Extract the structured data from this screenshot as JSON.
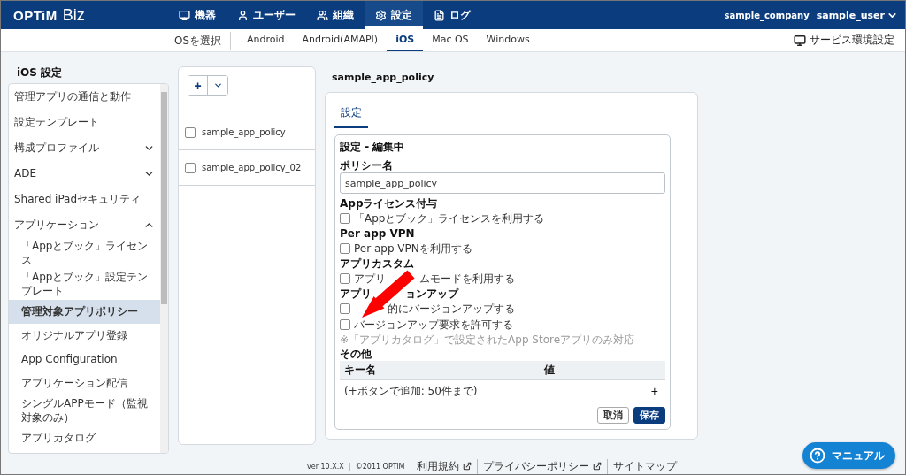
{
  "header": {
    "brand": "OPTiM",
    "product": "Biz",
    "company": "sample_company",
    "user": "sample_user",
    "nav": [
      {
        "label": "機器",
        "selected": false
      },
      {
        "label": "ユーザー",
        "selected": false
      },
      {
        "label": "組織",
        "selected": false
      },
      {
        "label": "設定",
        "selected": true
      },
      {
        "label": "ログ",
        "selected": false
      }
    ]
  },
  "subnav": {
    "label": "OSを選択",
    "service_link": "サービス環境設定",
    "os_tabs": [
      {
        "label": "Android",
        "selected": false
      },
      {
        "label": "Android(AMAPI)",
        "selected": false
      },
      {
        "label": "iOS",
        "selected": true
      },
      {
        "label": "Mac OS",
        "selected": false
      },
      {
        "label": "Windows",
        "selected": false
      }
    ]
  },
  "sidebar": {
    "title": "iOS 設定",
    "items": [
      {
        "label": "管理アプリの通信と動作",
        "selected": false
      },
      {
        "label": "設定テンプレート",
        "selected": false
      },
      {
        "label": "構成プロファイル",
        "selected": false,
        "expanded": false
      },
      {
        "label": "ADE",
        "selected": false,
        "expanded": false
      },
      {
        "label": "Shared iPadセキュリティ",
        "selected": false
      },
      {
        "label": "アプリケーション",
        "selected": false,
        "expanded": true,
        "children": [
          {
            "label": "「Appとブック」ライセンス",
            "selected": false
          },
          {
            "label": "「Appとブック」設定テンプレート",
            "selected": false
          },
          {
            "label": "管理対象アプリポリシー",
            "selected": true
          },
          {
            "label": "オリジナルアプリ登録",
            "selected": false
          },
          {
            "label": "App Configuration",
            "selected": false
          },
          {
            "label": "アプリケーション配信",
            "selected": false
          },
          {
            "label": "シングルAPPモード（監視対象のみ）",
            "selected": false
          },
          {
            "label": "アプリカタログ",
            "selected": false
          }
        ]
      }
    ]
  },
  "policy_list": {
    "add_button": "+",
    "items": [
      {
        "name": "sample_app_policy",
        "checked": false
      },
      {
        "name": "sample_app_policy_02",
        "checked": false
      }
    ]
  },
  "detail": {
    "title": "sample_app_policy",
    "tabs": [
      {
        "label": "設定",
        "selected": true
      }
    ],
    "form": {
      "heading": "設定 - 編集中",
      "name_label": "ポリシー名",
      "name_value": "sample_app_policy",
      "sections": [
        {
          "label_parts": [
            "Appライセンス付与"
          ],
          "options": [
            {
              "label_parts": [
                "「Appとブック」ライセンスを利用する"
              ],
              "checked": false
            }
          ]
        },
        {
          "label_parts": [
            "Per app VPN"
          ],
          "options": [
            {
              "label_parts": [
                "Per app VPNを利用する"
              ],
              "checked": false
            }
          ]
        },
        {
          "label_parts": [
            "アプリカスタム"
          ],
          "options": [
            {
              "label_parts": [
                "アプリ",
                "ムモードを利用する"
              ],
              "checked": false
            }
          ]
        },
        {
          "label_parts": [
            "アプリ",
            "ョンアップ"
          ],
          "options": [
            {
              "label_parts": [
                "的にバージョンアップする"
              ],
              "covered_start": true,
              "checked": false
            },
            {
              "label_parts": [
                "バージョンアップ要求を許可する"
              ],
              "checked": false
            }
          ],
          "note": "※「アプリカタログ」で設定されたApp Storeアプリのみ対応"
        }
      ],
      "other": {
        "label": "その他",
        "columns": [
          "キー名",
          "値"
        ],
        "empty_row": "(+ボタンで追加: 50件まで)",
        "add": "+"
      },
      "buttons": [
        {
          "label": "取消",
          "kind": "secondary"
        },
        {
          "label": "保存",
          "kind": "primary"
        }
      ]
    }
  },
  "footer": {
    "version": "ver 10.X.X",
    "copyright": "©2011 OPTiM",
    "links": [
      {
        "label": "利用規約",
        "external": true
      },
      {
        "label": "プライバシーポリシー",
        "external": true
      },
      {
        "label": "サイトマップ",
        "external": false
      }
    ]
  },
  "manual_button": "マニュアル"
}
